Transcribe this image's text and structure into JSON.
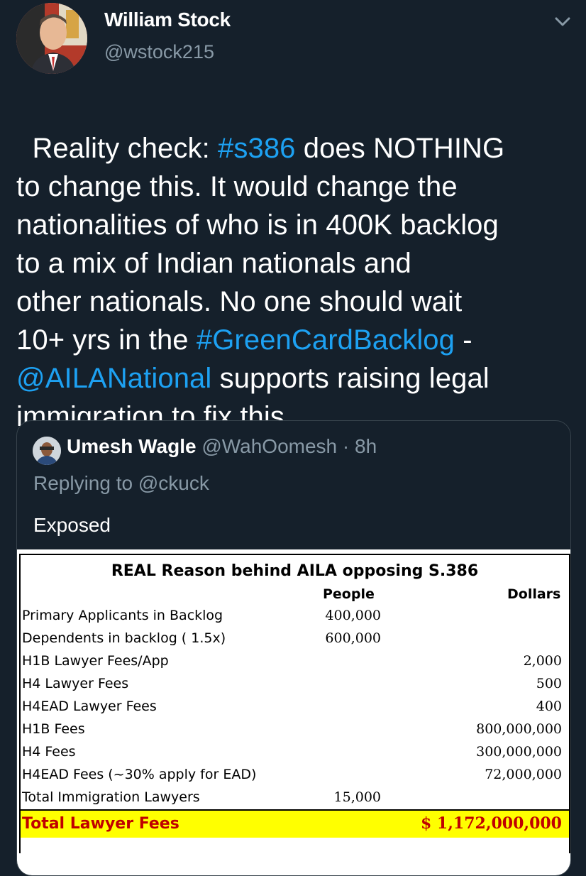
{
  "author": {
    "display_name": "William Stock",
    "handle": "@wstock215"
  },
  "tweet": {
    "segments": [
      {
        "text": "Reality check: ",
        "type": "text"
      },
      {
        "text": "#s386",
        "type": "link"
      },
      {
        "text": " does NOTHING\nto change this. It would change the\nnationalities of who is in 400K backlog\nto a mix of Indian nationals and\nother nationals. No one should wait\n10+ yrs in the ",
        "type": "text"
      },
      {
        "text": "#GreenCardBacklog",
        "type": "link"
      },
      {
        "text": " -\n",
        "type": "text"
      },
      {
        "text": "@AILANational",
        "type": "link"
      },
      {
        "text": " supports raising legal\nimmigration to fix this.",
        "type": "text"
      }
    ]
  },
  "quoted": {
    "name": "Umesh Wagle",
    "meta": " @WahOomesh · 8h",
    "replying": "Replying to @ckuck",
    "text": "Exposed",
    "sheet": {
      "title": "REAL Reason behind AILA opposing S.386",
      "col_people": "People",
      "col_dollars": "Dollars",
      "rows": [
        {
          "label": "Primary Applicants in Backlog",
          "people": "400,000",
          "dollars": ""
        },
        {
          "label": "Dependents in backlog ( 1.5x)",
          "people": "600,000",
          "dollars": ""
        },
        {
          "label": "H1B Lawyer Fees/App",
          "people": "",
          "dollars": "2,000"
        },
        {
          "label": "H4 Lawyer Fees",
          "people": "",
          "dollars": "500"
        },
        {
          "label": "H4EAD Lawyer Fees",
          "people": "",
          "dollars": "400"
        },
        {
          "label": "H1B Fees",
          "people": "",
          "dollars": "800,000,000"
        },
        {
          "label": "H4 Fees",
          "people": "",
          "dollars": "300,000,000"
        },
        {
          "label": "H4EAD Fees (~30% apply for EAD)",
          "people": "",
          "dollars": "72,000,000"
        },
        {
          "label": "Total Immigration Lawyers",
          "people": "15,000",
          "dollars": ""
        }
      ],
      "total": {
        "label": "Total Lawyer Fees",
        "dollars": "$  1,172,000,000"
      }
    }
  },
  "icons": {
    "caret": "chevron-down-icon"
  },
  "colors": {
    "background": "#15202b",
    "link": "#1da1f2",
    "muted": "#8899a6",
    "highlight": "#ffff00",
    "total_text": "#c00000"
  }
}
